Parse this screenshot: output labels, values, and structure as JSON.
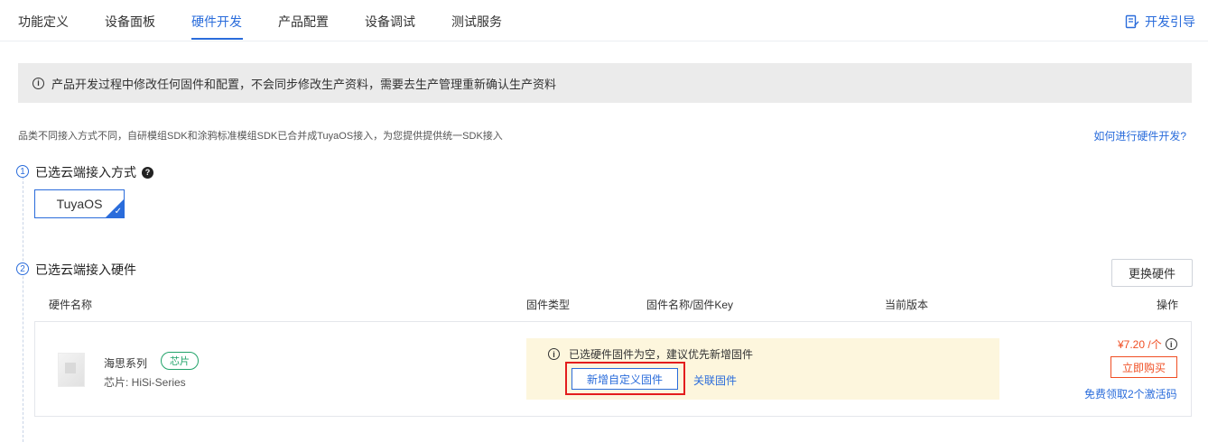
{
  "tabs": [
    "功能定义",
    "设备面板",
    "硬件开发",
    "产品配置",
    "设备调试",
    "测试服务"
  ],
  "active_tab": "硬件开发",
  "guide_label": "开发引导",
  "notice": "产品开发过程中修改任何固件和配置，不会同步修改生产资料，需要去生产管理重新确认生产资料",
  "description": "品类不同接入方式不同，自研模组SDK和涂鸦标准模组SDK已合并成TuyaOS接入，为您提供提供统一SDK接入",
  "howto_link": "如何进行硬件开发?",
  "steps": [
    {
      "num": "1",
      "title": "已选云端接入方式"
    },
    {
      "num": "2",
      "title": "已选云端接入硬件"
    }
  ],
  "access_option": "TuyaOS",
  "change_button": "更换硬件",
  "table_headers": {
    "name": "硬件名称",
    "fw_type": "固件类型",
    "fw_name": "固件名称/固件Key",
    "version": "当前版本",
    "action": "操作"
  },
  "hardware": {
    "name": "海思系列",
    "badge": "芯片",
    "chip_label": "芯片: HiSi-Series",
    "fw_warning": "已选硬件固件为空，建议优先新增固件",
    "add_firmware": "新增自定义固件",
    "link_firmware": "关联固件",
    "price": "¥7.20 /个",
    "buy_button": "立即购买",
    "free_link": "免费领取2个激活码"
  },
  "colors": {
    "accent": "#2a6cdb",
    "price": "#f04e23",
    "chip_badge": "#22a36a",
    "highlight": "#e31d1d",
    "warning_bg": "#fdf6dd"
  }
}
